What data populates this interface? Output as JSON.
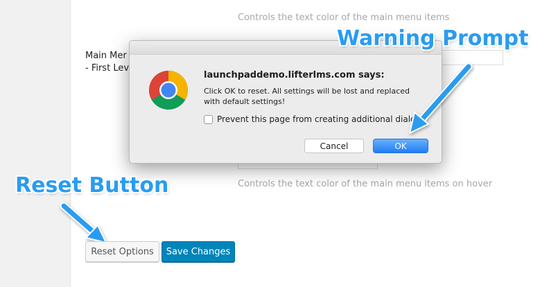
{
  "settings": {
    "desc_top": "Controls the text color of the main menu items",
    "field_label_line1": "Main Mer",
    "field_label_line2": "- First Lev",
    "desc_bottom": "Controls the text color of the main menu items on hover"
  },
  "dialog": {
    "title": "launchpaddemo.lifterlms.com says:",
    "message": "Click OK to reset. All settings will be lost and replaced with default settings!",
    "prevent_label": "Prevent this page from creating additional dialog",
    "prevent_checked": false,
    "cancel_label": "Cancel",
    "ok_label": "OK",
    "icon": "chrome-logo-icon"
  },
  "annotations": {
    "warning_label": "Warning Prompt",
    "reset_label": "Reset Button",
    "color": "#2a9cf0"
  },
  "actions": {
    "reset_label": "Reset Options",
    "save_label": "Save Changes",
    "save_color": "#0085ba"
  }
}
